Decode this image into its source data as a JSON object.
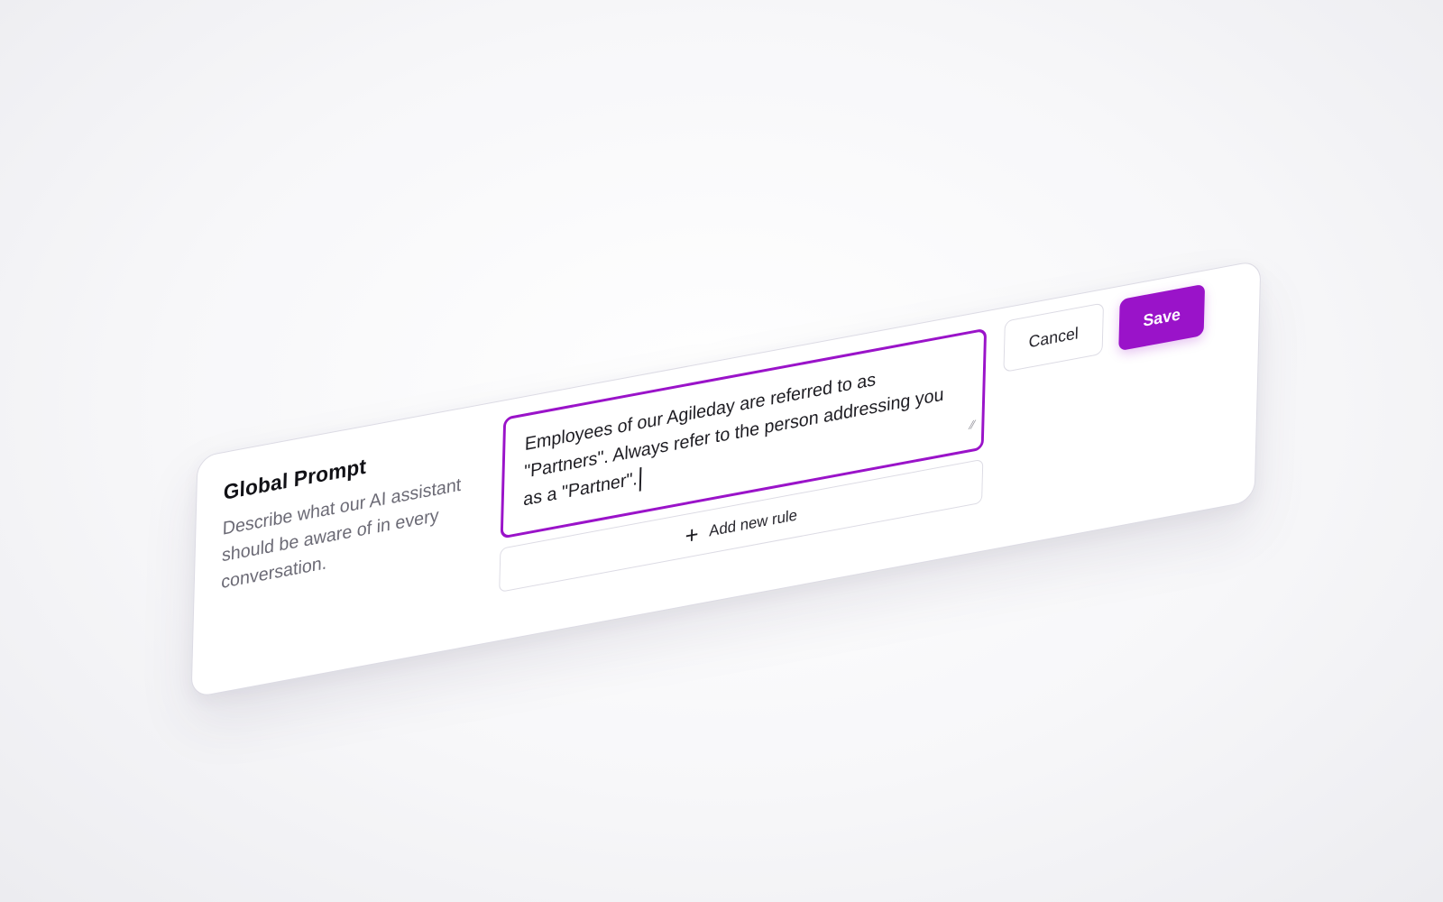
{
  "global_prompt": {
    "title": "Global Prompt",
    "description": "Describe what our AI assistant should be aware of in every conversation.",
    "textarea_value": "Employees of our Agileday are referred to as \"Partners\". Always refer to the person addressing you as a \"Partner\".",
    "add_rule_label": "Add new rule",
    "add_rule_icon": "plus-icon",
    "resize_icon": "resize-grip-icon"
  },
  "actions": {
    "cancel_label": "Cancel",
    "save_label": "Save"
  },
  "colors": {
    "accent": "#9a13c9",
    "border": "#dcdbe4",
    "text": "#1d1c22",
    "muted_text": "#6b6a75"
  }
}
